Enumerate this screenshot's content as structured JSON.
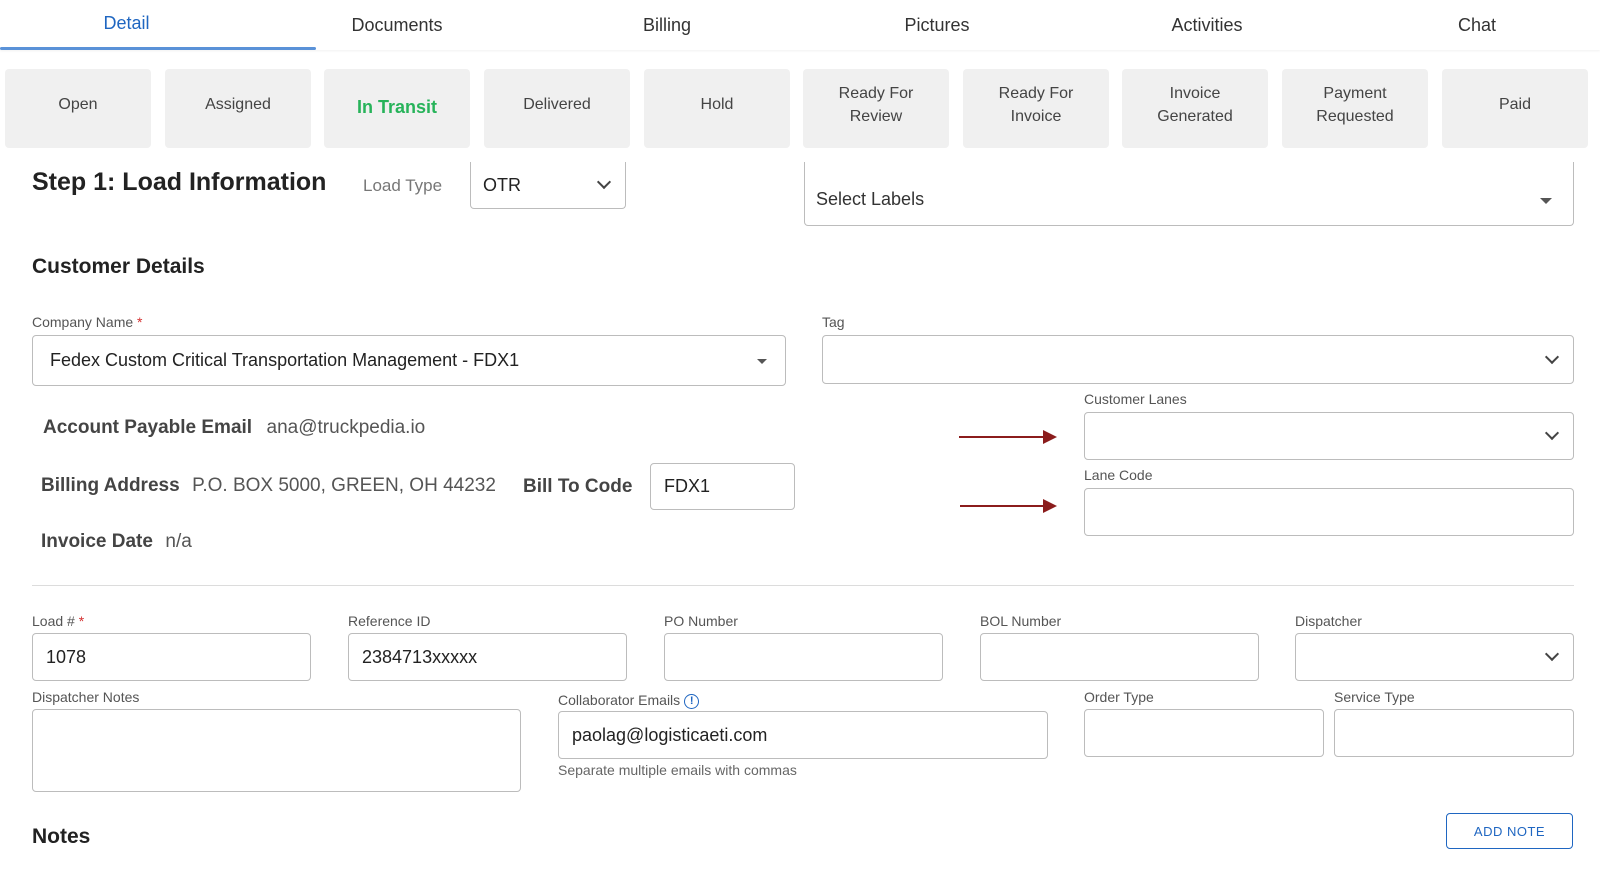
{
  "tabs": [
    "Detail",
    "Documents",
    "Billing",
    "Pictures",
    "Activities",
    "Chat"
  ],
  "active_tab": "Detail",
  "statuses": [
    "Open",
    "Assigned",
    "In Transit",
    "Delivered",
    "Hold",
    "Ready For\nReview",
    "Ready For\nInvoice",
    "Invoice\nGenerated",
    "Payment\nRequested",
    "Paid"
  ],
  "active_status": "In Transit",
  "step": {
    "title": "Step 1: Load Information",
    "load_type_label": "Load Type",
    "load_type_value": "OTR",
    "labels_placeholder": "Select Labels"
  },
  "customer": {
    "title": "Customer Details",
    "company_label": "Company Name",
    "required_mark": "*",
    "company_value": "Fedex Custom Critical Transportation Management - FDX1",
    "tag_label": "Tag",
    "tag_value": "",
    "ap_email_key": "Account Payable Email",
    "ap_email_value": "ana@truckpedia.io",
    "billing_address_key": "Billing Address",
    "billing_address_value": "P.O. BOX 5000, GREEN, OH 44232",
    "bill_to_code_key": "Bill To Code",
    "bill_to_code_value": "FDX1",
    "invoice_date_key": "Invoice Date",
    "invoice_date_value": "n/a",
    "customer_lanes_label": "Customer Lanes",
    "customer_lanes_value": "",
    "lane_code_label": "Lane Code",
    "lane_code_value": ""
  },
  "load": {
    "load_no_label": "Load #",
    "load_no_value": "1078",
    "reference_label": "Reference ID",
    "reference_value": "2384713xxxxx",
    "po_label": "PO Number",
    "po_value": "",
    "bol_label": "BOL Number",
    "bol_value": "",
    "dispatcher_label": "Dispatcher",
    "dispatcher_value": "",
    "dispatcher_notes_label": "Dispatcher Notes",
    "dispatcher_notes_value": "",
    "collaborator_label": "Collaborator Emails",
    "collaborator_value": "paolag@logisticaeti.com",
    "collaborator_help": "Separate multiple emails with commas",
    "order_type_label": "Order Type",
    "order_type_value": "",
    "service_type_label": "Service Type",
    "service_type_value": ""
  },
  "notes": {
    "title": "Notes",
    "add_button": "ADD NOTE"
  },
  "colors": {
    "accent": "#1f66c1",
    "active_status": "#27b35a",
    "annotation_arrow": "#8b1c1c"
  }
}
